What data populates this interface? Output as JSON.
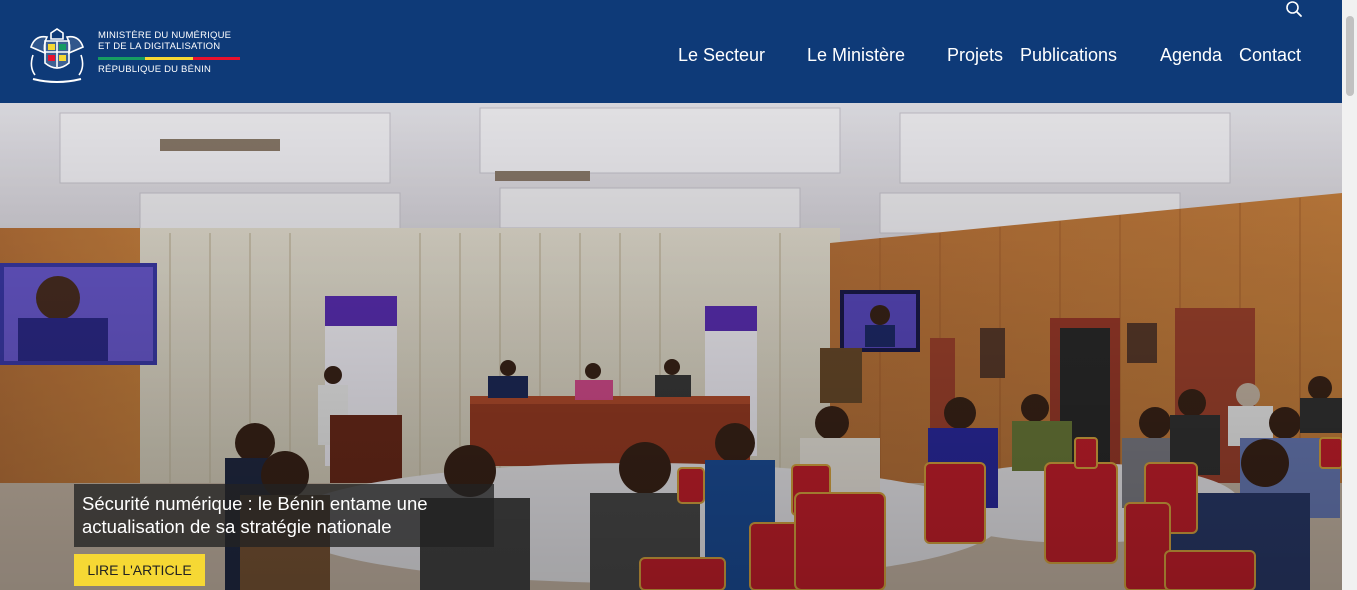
{
  "header": {
    "logo": {
      "line1": "MINISTÈRE DU NUMÉRIQUE",
      "line2": "ET DE LA DIGITALISATION",
      "line3": "RÉPUBLIQUE DU BÉNIN",
      "flag_colors": [
        "#169b62",
        "#f6d834",
        "#e8112d"
      ]
    },
    "search_icon": "search-icon",
    "nav": {
      "secteur": "Le Secteur",
      "ministere": "Le Ministère",
      "projets": "Projets",
      "publications": "Publications",
      "agenda": "Agenda",
      "contact": "Contact"
    },
    "background_color": "#0e3a78"
  },
  "hero": {
    "headline": "Sécurité numérique : le Bénin entame une actualisation de sa stratégie nationale",
    "cta_label": "LIRE L'ARTICLE",
    "cta_color": "#f6d834"
  }
}
